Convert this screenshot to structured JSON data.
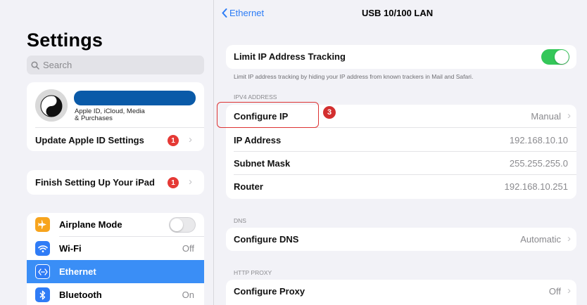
{
  "left": {
    "title": "Settings",
    "search_placeholder": "Search",
    "account": {
      "subtitle_line1": "Apple ID, iCloud, Media",
      "subtitle_line2": "& Purchases",
      "update_label": "Update Apple ID Settings",
      "update_badge": "1"
    },
    "finish": {
      "label": "Finish Setting Up Your iPad",
      "badge": "1"
    },
    "items": [
      {
        "label": "Airplane Mode",
        "value": "",
        "icon": "airplane-icon",
        "color": "#f7a41d"
      },
      {
        "label": "Wi-Fi",
        "value": "Off",
        "icon": "wifi-icon",
        "color": "#2f7cf6"
      },
      {
        "label": "Ethernet",
        "value": "",
        "icon": "ethernet-icon",
        "color": "#2f7cf6"
      },
      {
        "label": "Bluetooth",
        "value": "On",
        "icon": "bluetooth-icon",
        "color": "#2f7cf6"
      }
    ]
  },
  "right": {
    "back_label": "Ethernet",
    "title": "USB 10/100 LAN",
    "limit_tracking": {
      "label": "Limit IP Address Tracking",
      "footnote": "Limit IP address tracking by hiding your IP address from known trackers in Mail and Safari."
    },
    "ipv4_header": "IPV4 ADDRESS",
    "ipv4_rows": [
      {
        "label": "Configure IP",
        "value": "Manual"
      },
      {
        "label": "IP Address",
        "value": "192.168.10.10"
      },
      {
        "label": "Subnet Mask",
        "value": "255.255.255.0"
      },
      {
        "label": "Router",
        "value": "192.168.10.251"
      }
    ],
    "dns_header": "DNS",
    "dns_row": {
      "label": "Configure DNS",
      "value": "Automatic"
    },
    "proxy_header": "HTTP PROXY",
    "proxy_row": {
      "label": "Configure Proxy",
      "value": "Off"
    }
  },
  "annotation": {
    "step": "3"
  },
  "colors": {
    "accent": "#2c7cf6",
    "toggle_on": "#34c759",
    "badge": "#e53935",
    "annotation": "#d33"
  }
}
